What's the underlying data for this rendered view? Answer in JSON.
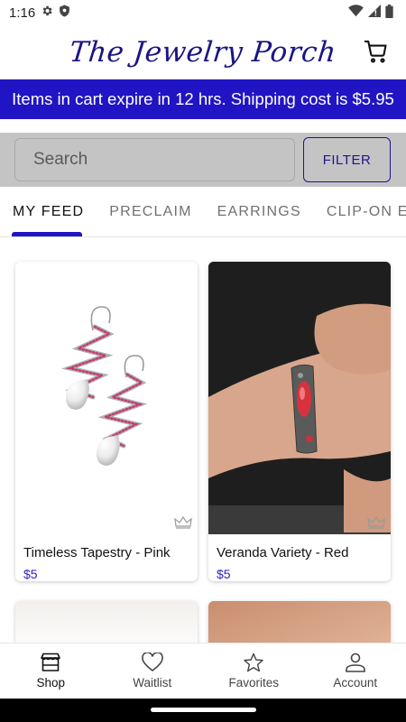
{
  "status_bar": {
    "time": "1:16"
  },
  "header": {
    "brand": "The Jewelry Porch"
  },
  "banner": {
    "text": "Items in cart expire in 12 hrs. Shipping cost is $5.95"
  },
  "search": {
    "placeholder": "Search",
    "filter_label": "FILTER"
  },
  "tabs": [
    {
      "label": "MY FEED",
      "active": true
    },
    {
      "label": "PRECLAIM",
      "active": false
    },
    {
      "label": "EARRINGS",
      "active": false
    },
    {
      "label": "CLIP-ON EARRINGS",
      "active": false
    }
  ],
  "products": [
    {
      "name": "Timeless Tapestry - Pink",
      "price": "$5"
    },
    {
      "name": "Veranda Variety - Red",
      "price": "$5"
    }
  ],
  "bottom_nav": [
    {
      "label": "Shop",
      "icon": "store-icon",
      "active": true
    },
    {
      "label": "Waitlist",
      "icon": "heart-icon",
      "active": false
    },
    {
      "label": "Favorites",
      "icon": "star-icon",
      "active": false
    },
    {
      "label": "Account",
      "icon": "person-icon",
      "active": false
    }
  ],
  "colors": {
    "primary": "#2114c4",
    "brand": "#1b1583",
    "search_bg": "#c4c4c4"
  }
}
